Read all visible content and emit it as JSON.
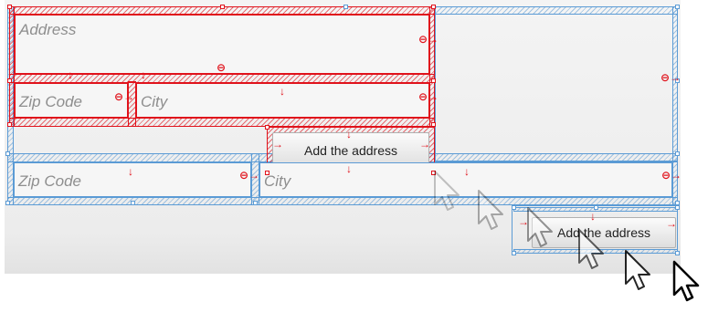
{
  "form": {
    "address_placeholder": "Address",
    "zip_placeholder": "Zip Code",
    "city_placeholder": "City",
    "add_button_label": "Add the address"
  },
  "duplicate": {
    "zip_placeholder": "Zip Code",
    "city_placeholder": "City",
    "add_button_label": "Add the address"
  },
  "colors": {
    "selected_outline": "#e0121b",
    "guide_outline": "#5b9bd5",
    "canvas": "#ececec"
  },
  "icons": [
    "resize-handle-icon",
    "constraint-arrow-icon",
    "cursor-icon"
  ]
}
